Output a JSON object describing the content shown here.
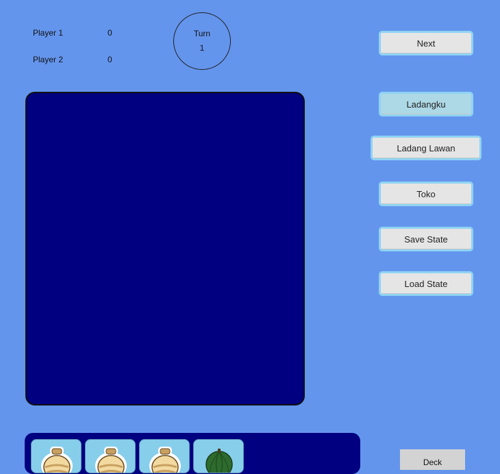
{
  "scoreboard": {
    "player1_label": "Player 1",
    "player1_score": "0",
    "player2_label": "Player 2",
    "player2_score": "0"
  },
  "turn": {
    "label": "Turn",
    "value": "1"
  },
  "nav": {
    "next": "Next",
    "ladangku": "Ladangku",
    "ladang_lawan": "Ladang Lawan",
    "toko": "Toko",
    "save_state": "Save State",
    "load_state": "Load State",
    "active": "ladangku"
  },
  "hand": {
    "cards": [
      {
        "icon": "jar-icon"
      },
      {
        "icon": "jar-icon"
      },
      {
        "icon": "jar-icon"
      },
      {
        "icon": "pumpkin-icon"
      }
    ]
  },
  "deck": {
    "label": "Deck"
  },
  "colors": {
    "background": "#6495ed",
    "field": "#000080",
    "card": "#87ceeb",
    "button_border": "#8fd3f3",
    "active_button": "#add8e6"
  }
}
